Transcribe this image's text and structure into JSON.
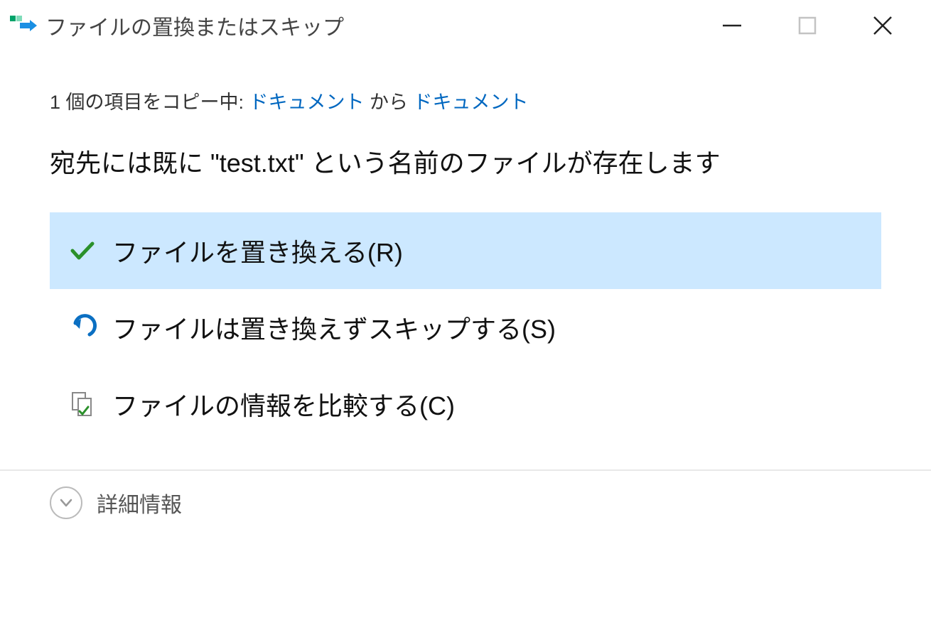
{
  "titlebar": {
    "title": "ファイルの置換またはスキップ"
  },
  "copy_status": {
    "prefix": "1 個の項目をコピー中: ",
    "source": "ドキュメント",
    "middle": " から ",
    "destination": "ドキュメント"
  },
  "message": "宛先には既に \"test.txt\" という名前のファイルが存在します",
  "options": {
    "replace": "ファイルを置き換える(R)",
    "skip": "ファイルは置き換えずスキップする(S)",
    "compare": "ファイルの情報を比較する(C)"
  },
  "details_toggle": "詳細情報"
}
